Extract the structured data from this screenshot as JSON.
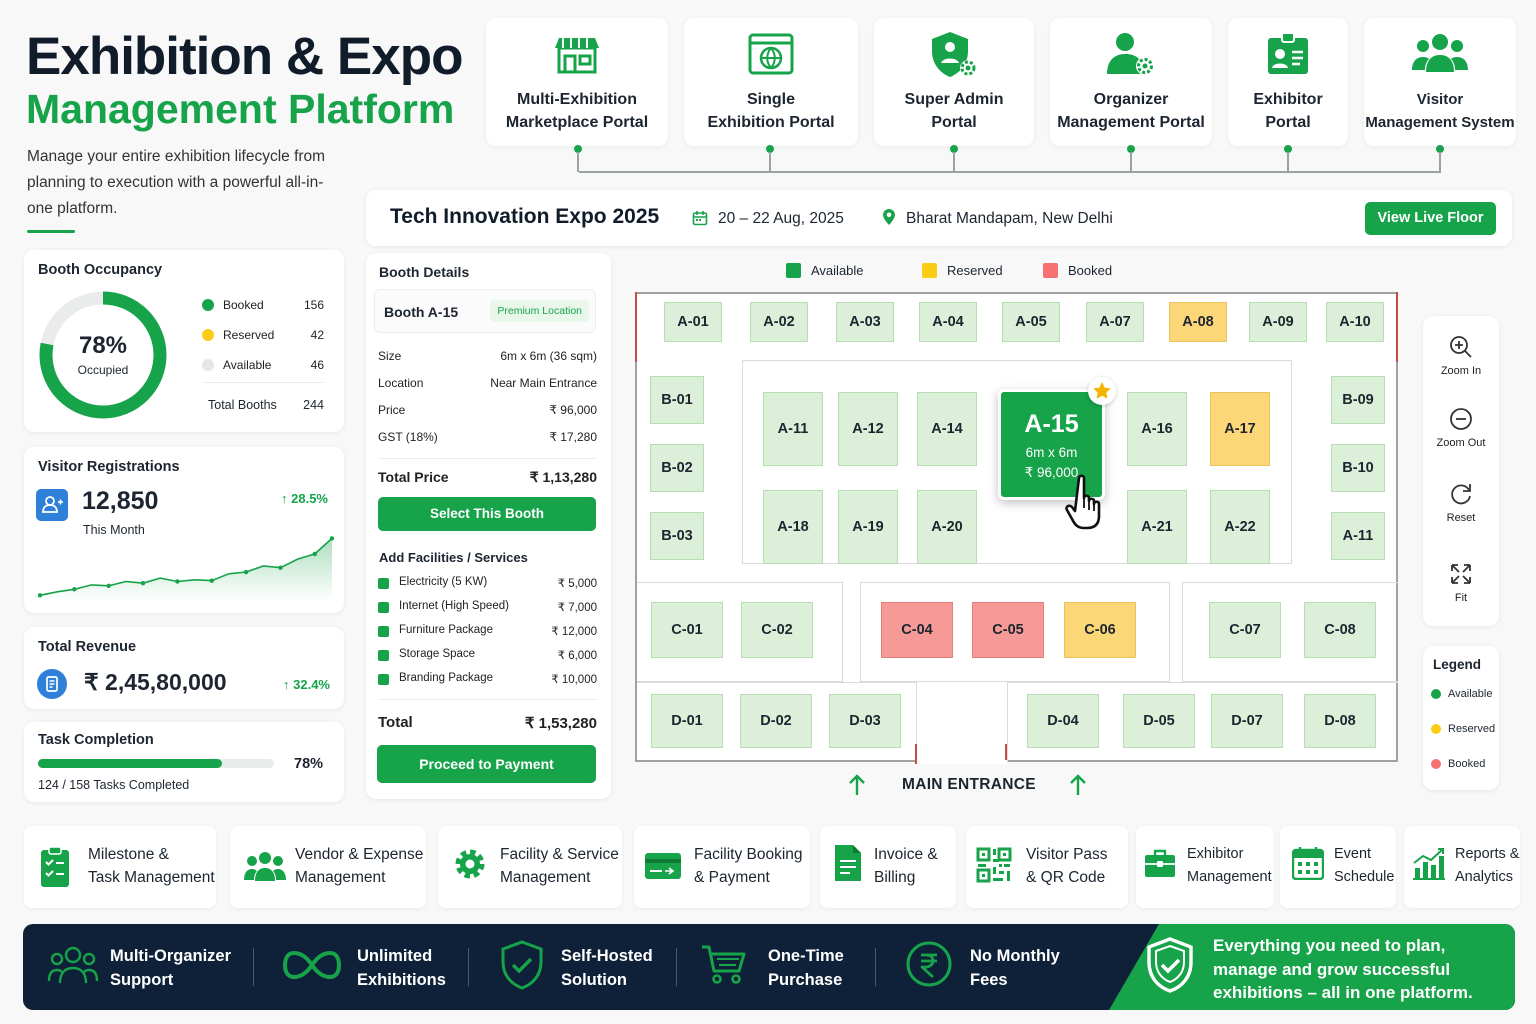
{
  "header": {
    "title_line1": "Exhibition & Expo",
    "title_line2": "Management Platform",
    "description": "Manage your entire exhibition lifecycle from planning to execution with a powerful all-in-one platform."
  },
  "portals": [
    {
      "line1": "Multi-Exhibition",
      "line2": "Marketplace Portal",
      "icon": "store-icon"
    },
    {
      "line1": "Single",
      "line2": "Exhibition Portal",
      "icon": "globe-window-icon"
    },
    {
      "line1": "Super Admin",
      "line2": "Portal",
      "icon": "shield-gear-icon"
    },
    {
      "line1": "Organizer",
      "line2": "Management Portal",
      "icon": "user-gear-icon"
    },
    {
      "line1": "Exhibitor",
      "line2": "Portal",
      "icon": "id-badge-icon"
    },
    {
      "line1": "Visitor",
      "line2": "Management System",
      "icon": "users-icon"
    }
  ],
  "event": {
    "title": "Tech Innovation Expo 2025",
    "date": "20 – 22 Aug, 2025",
    "location": "Bharat Mandapam, New Delhi",
    "view_button": "View Live Floor"
  },
  "occupancy": {
    "title": "Booth Occupancy",
    "percent_label": "78%",
    "percent": 78,
    "occupied_label": "Occupied",
    "items": [
      {
        "label": "Booked",
        "value": "156",
        "color": "#16a34a"
      },
      {
        "label": "Reserved",
        "value": "42",
        "color": "#facc15"
      },
      {
        "label": "Available",
        "value": "46",
        "color": "#e5e7eb"
      }
    ],
    "total_label": "Total Booths",
    "total_value": "244"
  },
  "visitors": {
    "title": "Visitor Registrations",
    "value": "12,850",
    "sub": "This Month",
    "change": "↑ 28.5%",
    "trend": [
      2,
      6,
      9,
      14,
      13,
      18,
      16,
      22,
      18,
      20,
      19,
      27,
      29,
      36,
      34,
      44,
      50,
      68
    ]
  },
  "revenue": {
    "title": "Total Revenue",
    "value": "₹ 2,45,80,000",
    "change": "↑ 32.4%"
  },
  "tasks": {
    "title": "Task Completion",
    "percent_label": "78%",
    "percent": 78,
    "sub": "124 / 158 Tasks Completed"
  },
  "booth_details": {
    "title": "Booth Details",
    "booth_name": "Booth A-15",
    "badge": "Premium Location",
    "rows": [
      {
        "label": "Size",
        "value": "6m x 6m (36 sqm)"
      },
      {
        "label": "Location",
        "value": "Near Main Entrance"
      },
      {
        "label": "Price",
        "value": "₹ 96,000"
      },
      {
        "label": "GST (18%)",
        "value": "₹ 17,280"
      }
    ],
    "total_price_label": "Total Price",
    "total_price_value": "₹ 1,13,280",
    "select_button": "Select This Booth",
    "facilities_title": "Add Facilities / Services",
    "facilities": [
      {
        "label": "Electricity (5 KW)",
        "value": "₹ 5,000"
      },
      {
        "label": "Internet (High Speed)",
        "value": "₹ 7,000"
      },
      {
        "label": "Furniture Package",
        "value": "₹ 12,000"
      },
      {
        "label": "Storage Space",
        "value": "₹ 6,000"
      },
      {
        "label": "Branding Package",
        "value": "₹ 10,000"
      }
    ],
    "total_label": "Total",
    "total_value": "₹ 1,53,280",
    "pay_button": "Proceed to Payment"
  },
  "floor_legend": [
    {
      "label": "Available",
      "color": "#16a34a"
    },
    {
      "label": "Reserved",
      "color": "#facc15"
    },
    {
      "label": "Booked",
      "color": "#f87171"
    }
  ],
  "booths": {
    "row_a": [
      {
        "id": "A-01",
        "status": "available"
      },
      {
        "id": "A-02",
        "status": "available"
      },
      {
        "id": "A-03",
        "status": "available"
      },
      {
        "id": "A-04",
        "status": "available"
      },
      {
        "id": "A-05",
        "status": "available"
      },
      {
        "id": "A-07",
        "status": "available"
      },
      {
        "id": "A-08",
        "status": "reserved"
      },
      {
        "id": "A-09",
        "status": "available"
      },
      {
        "id": "A-10",
        "status": "available"
      }
    ],
    "left_b": [
      "B-01",
      "B-02",
      "B-03"
    ],
    "right_b": [
      "B-09",
      "B-10",
      "A-11"
    ],
    "inner_top": [
      {
        "id": "A-11",
        "status": "available"
      },
      {
        "id": "A-12",
        "status": "available"
      },
      {
        "id": "A-14",
        "status": "available"
      },
      {
        "id": "A-16",
        "status": "available"
      },
      {
        "id": "A-17",
        "status": "reserved"
      }
    ],
    "inner_bottom": [
      {
        "id": "A-18",
        "status": "available"
      },
      {
        "id": "A-19",
        "status": "available"
      },
      {
        "id": "A-20",
        "status": "available"
      },
      {
        "id": "A-21",
        "status": "available"
      },
      {
        "id": "A-22",
        "status": "available"
      }
    ],
    "row_c": [
      {
        "id": "C-01",
        "status": "available"
      },
      {
        "id": "C-02",
        "status": "available"
      },
      {
        "id": "C-04",
        "status": "booked"
      },
      {
        "id": "C-05",
        "status": "booked"
      },
      {
        "id": "C-06",
        "status": "reserved"
      },
      {
        "id": "C-07",
        "status": "available"
      },
      {
        "id": "C-08",
        "status": "available"
      }
    ],
    "row_d": [
      {
        "id": "D-01",
        "status": "available"
      },
      {
        "id": "D-02",
        "status": "available"
      },
      {
        "id": "D-03",
        "status": "available"
      },
      {
        "id": "D-04",
        "status": "available"
      },
      {
        "id": "D-05",
        "status": "available"
      },
      {
        "id": "D-07",
        "status": "available"
      },
      {
        "id": "D-08",
        "status": "available"
      }
    ],
    "selected": {
      "id": "A-15",
      "size": "6m x 6m",
      "price": "₹ 96,000"
    }
  },
  "entrance_label": "MAIN ENTRANCE",
  "tools": [
    {
      "label": "Zoom In",
      "icon": "zoom-in-icon"
    },
    {
      "label": "Zoom Out",
      "icon": "zoom-out-icon"
    },
    {
      "label": "Reset",
      "icon": "reset-icon"
    },
    {
      "label": "Fit",
      "icon": "fit-icon"
    }
  ],
  "side_legend": {
    "title": "Legend",
    "items": [
      {
        "label": "Available",
        "color": "#16a34a"
      },
      {
        "label": "Reserved",
        "color": "#facc15"
      },
      {
        "label": "Booked",
        "color": "#f87171"
      }
    ]
  },
  "features": [
    {
      "line1": "Milestone &",
      "line2": "Task Management",
      "icon": "checklist-icon"
    },
    {
      "line1": "Vendor & Expense",
      "line2": "Management",
      "icon": "team-icon"
    },
    {
      "line1": "Facility & Service",
      "line2": "Management",
      "icon": "gear-icon"
    },
    {
      "line1": "Facility Booking",
      "line2": "& Payment",
      "icon": "card-icon"
    },
    {
      "line1": "Invoice &",
      "line2": "Billing",
      "icon": "invoice-icon"
    },
    {
      "line1": "Visitor Pass",
      "line2": "& QR Code",
      "icon": "qr-icon"
    },
    {
      "line1": "Exhibitor",
      "line2": "Management",
      "icon": "briefcase-icon"
    },
    {
      "line1": "Event",
      "line2": "Schedule",
      "icon": "calendar-icon"
    },
    {
      "line1": "Reports &",
      "line2": "Analytics",
      "icon": "bar-chart-icon"
    }
  ],
  "bottom_features": [
    {
      "line1": "Multi-Organizer",
      "line2": "Support",
      "icon": "users-outline-icon"
    },
    {
      "line1": "Unlimited",
      "line2": "Exhibitions",
      "icon": "infinity-icon"
    },
    {
      "line1": "Self-Hosted",
      "line2": "Solution",
      "icon": "shield-check-icon"
    },
    {
      "line1": "One-Time",
      "line2": "Purchase",
      "icon": "cart-icon"
    },
    {
      "line1": "No Monthly",
      "line2": "Fees",
      "icon": "rupee-coin-icon"
    }
  ],
  "tagline": {
    "line1": "Everything you need to plan,",
    "line2": "manage and grow successful",
    "line3": "exhibitions – all in one platform."
  }
}
